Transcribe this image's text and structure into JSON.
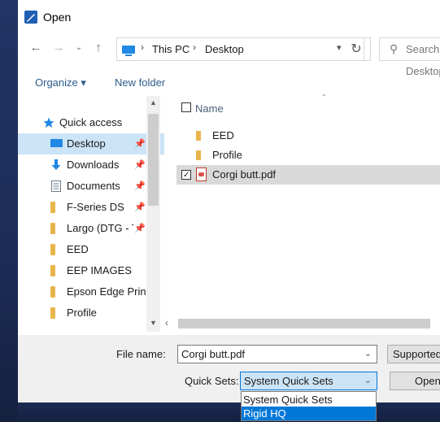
{
  "window": {
    "title": "Open"
  },
  "address": {
    "segments": [
      "This PC",
      "Desktop"
    ]
  },
  "search": {
    "placeholder": "Search Desktop"
  },
  "toolbar": {
    "organize": "Organize ▾",
    "new_folder": "New folder"
  },
  "nav": {
    "items": [
      {
        "label": "Quick access",
        "icon": "star-icon"
      },
      {
        "label": "Desktop",
        "icon": "desktop-icon",
        "pinned": true,
        "selected": true
      },
      {
        "label": "Downloads",
        "icon": "download-icon",
        "pinned": true
      },
      {
        "label": "Documents",
        "icon": "documents-icon",
        "pinned": true
      },
      {
        "label": "F-Series DS",
        "icon": "folder-icon",
        "pinned": true
      },
      {
        "label": "Largo (DTG - T",
        "icon": "folder-icon",
        "pinned": true
      },
      {
        "label": "EED",
        "icon": "folder-icon"
      },
      {
        "label": "EEP IMAGES",
        "icon": "folder-icon"
      },
      {
        "label": "Epson Edge Print",
        "icon": "folder-icon"
      },
      {
        "label": "Profile",
        "icon": "folder-icon"
      }
    ]
  },
  "files": {
    "column_name": "Name",
    "rows": [
      {
        "name": "EED",
        "type": "folder"
      },
      {
        "name": "Profile",
        "type": "folder"
      },
      {
        "name": "Corgi butt.pdf",
        "type": "pdf",
        "checked": true,
        "selected": true
      }
    ]
  },
  "footer": {
    "filename_label": "File name:",
    "filename_value": "Corgi butt.pdf",
    "filetype_value": "Supported Files",
    "quicksets_label": "Quick Sets:",
    "quicksets_value": "System Quick Sets",
    "open_label": "Open"
  },
  "quicksets_dropdown": {
    "options": [
      "System Quick Sets",
      "Rigid HQ"
    ],
    "highlighted": 1
  },
  "colors": {
    "accent": "#0078d7",
    "selection": "#cce4f7",
    "folder": "#e8b54b"
  }
}
